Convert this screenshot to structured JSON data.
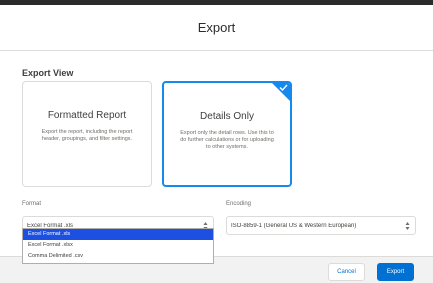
{
  "dialog": {
    "title": "Export"
  },
  "export_view": {
    "label": "Export View",
    "options": [
      {
        "title": "Formatted Report",
        "description": "Export the report, including the report header, groupings, and filter settings."
      },
      {
        "title": "Details Only",
        "description": "Export only the detail rows. Use this to do further calculations or for uploading to other systems.",
        "selected": true
      }
    ]
  },
  "format": {
    "label": "Format",
    "value": "Excel Format .xls",
    "options": [
      "Excel Format .xls",
      "Excel Format .xlsx",
      "Comma Delimited .csv"
    ]
  },
  "encoding": {
    "label": "Encoding",
    "value": "ISO-8859-1 (General US & Western European)"
  },
  "footer": {
    "cancel_label": "Cancel",
    "export_label": "Export"
  },
  "colors": {
    "accent": "#1589ee",
    "brand_button": "#0070d2",
    "dropdown_highlight": "#1d4fe0"
  }
}
